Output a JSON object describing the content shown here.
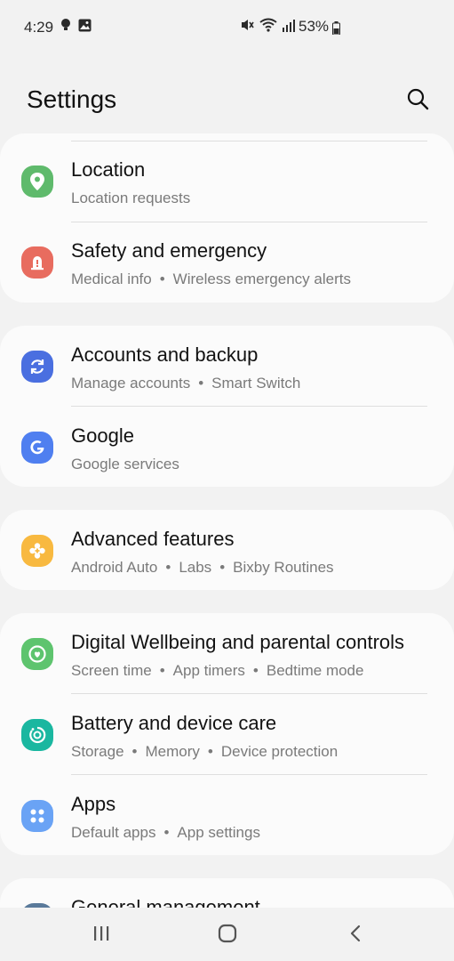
{
  "status_bar": {
    "time": "4:29",
    "battery_percent": "53%",
    "left_icons": [
      "notification-bulb-icon",
      "gallery-icon"
    ],
    "right_icons": [
      "mute-icon",
      "wifi-icon",
      "signal-icon",
      "battery-icon"
    ]
  },
  "header": {
    "title": "Settings",
    "search_icon": "search-icon"
  },
  "colors": {
    "location": "#5fba6c",
    "safety": "#e86c5f",
    "accounts": "#4a6fe0",
    "google": "#4f7ff0",
    "advanced": "#f8b940",
    "wellbeing": "#5ec46e",
    "battery": "#1ab7a0",
    "apps": "#6aa3f5",
    "general": "#5a7a9a"
  },
  "groups": [
    {
      "items": [
        {
          "title": "Location",
          "subtitle": [
            "Location requests"
          ],
          "icon": "location-pin-icon"
        },
        {
          "title": "Safety and emergency",
          "subtitle": [
            "Medical info",
            "Wireless emergency alerts"
          ],
          "icon": "emergency-alert-icon"
        }
      ]
    },
    {
      "items": [
        {
          "title": "Accounts and backup",
          "subtitle": [
            "Manage accounts",
            "Smart Switch"
          ],
          "icon": "sync-icon"
        },
        {
          "title": "Google",
          "subtitle": [
            "Google services"
          ],
          "icon": "google-g-icon"
        }
      ]
    },
    {
      "items": [
        {
          "title": "Advanced features",
          "subtitle": [
            "Android Auto",
            "Labs",
            "Bixby Routines"
          ],
          "icon": "gear-plus-icon"
        }
      ]
    },
    {
      "items": [
        {
          "title": "Digital Wellbeing and parental controls",
          "subtitle": [
            "Screen time",
            "App timers",
            "Bedtime mode"
          ],
          "icon": "wellbeing-heart-icon"
        },
        {
          "title": "Battery and device care",
          "subtitle": [
            "Storage",
            "Memory",
            "Device protection"
          ],
          "icon": "device-care-icon"
        },
        {
          "title": "Apps",
          "subtitle": [
            "Default apps",
            "App settings"
          ],
          "icon": "apps-grid-icon"
        }
      ]
    },
    {
      "items": [
        {
          "title": "General management",
          "subtitle": [],
          "icon": "general-management-icon"
        }
      ]
    }
  ],
  "nav": {
    "recents_icon": "recents-icon",
    "home_icon": "home-icon",
    "back_icon": "back-icon"
  }
}
